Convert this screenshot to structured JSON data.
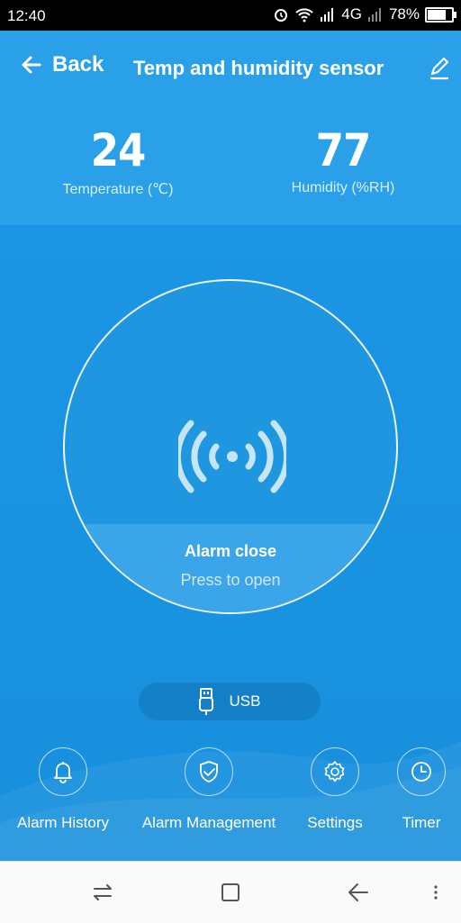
{
  "status": {
    "time": "12:40",
    "network": "4G",
    "battery": "78%",
    "battery_level": 0.78
  },
  "header": {
    "back_label": "Back",
    "title": "Temp and humidity sensor"
  },
  "metrics": {
    "temperature": {
      "value": "24",
      "label": "Temperature (℃)"
    },
    "humidity": {
      "value": "77",
      "label": "Humidity (%RH)"
    }
  },
  "alarm": {
    "title": "Alarm close",
    "subtitle": "Press to open"
  },
  "power": {
    "label": "USB"
  },
  "actions": [
    {
      "label": "Alarm History",
      "icon": "bell-icon"
    },
    {
      "label": "Alarm Management",
      "icon": "shield-check-icon"
    },
    {
      "label": "Settings",
      "icon": "gear-icon"
    },
    {
      "label": "Timer",
      "icon": "clock-icon"
    }
  ],
  "colors": {
    "accent": "#1a94e0",
    "band": "#2aa0e8",
    "pill": "#1480c7"
  }
}
